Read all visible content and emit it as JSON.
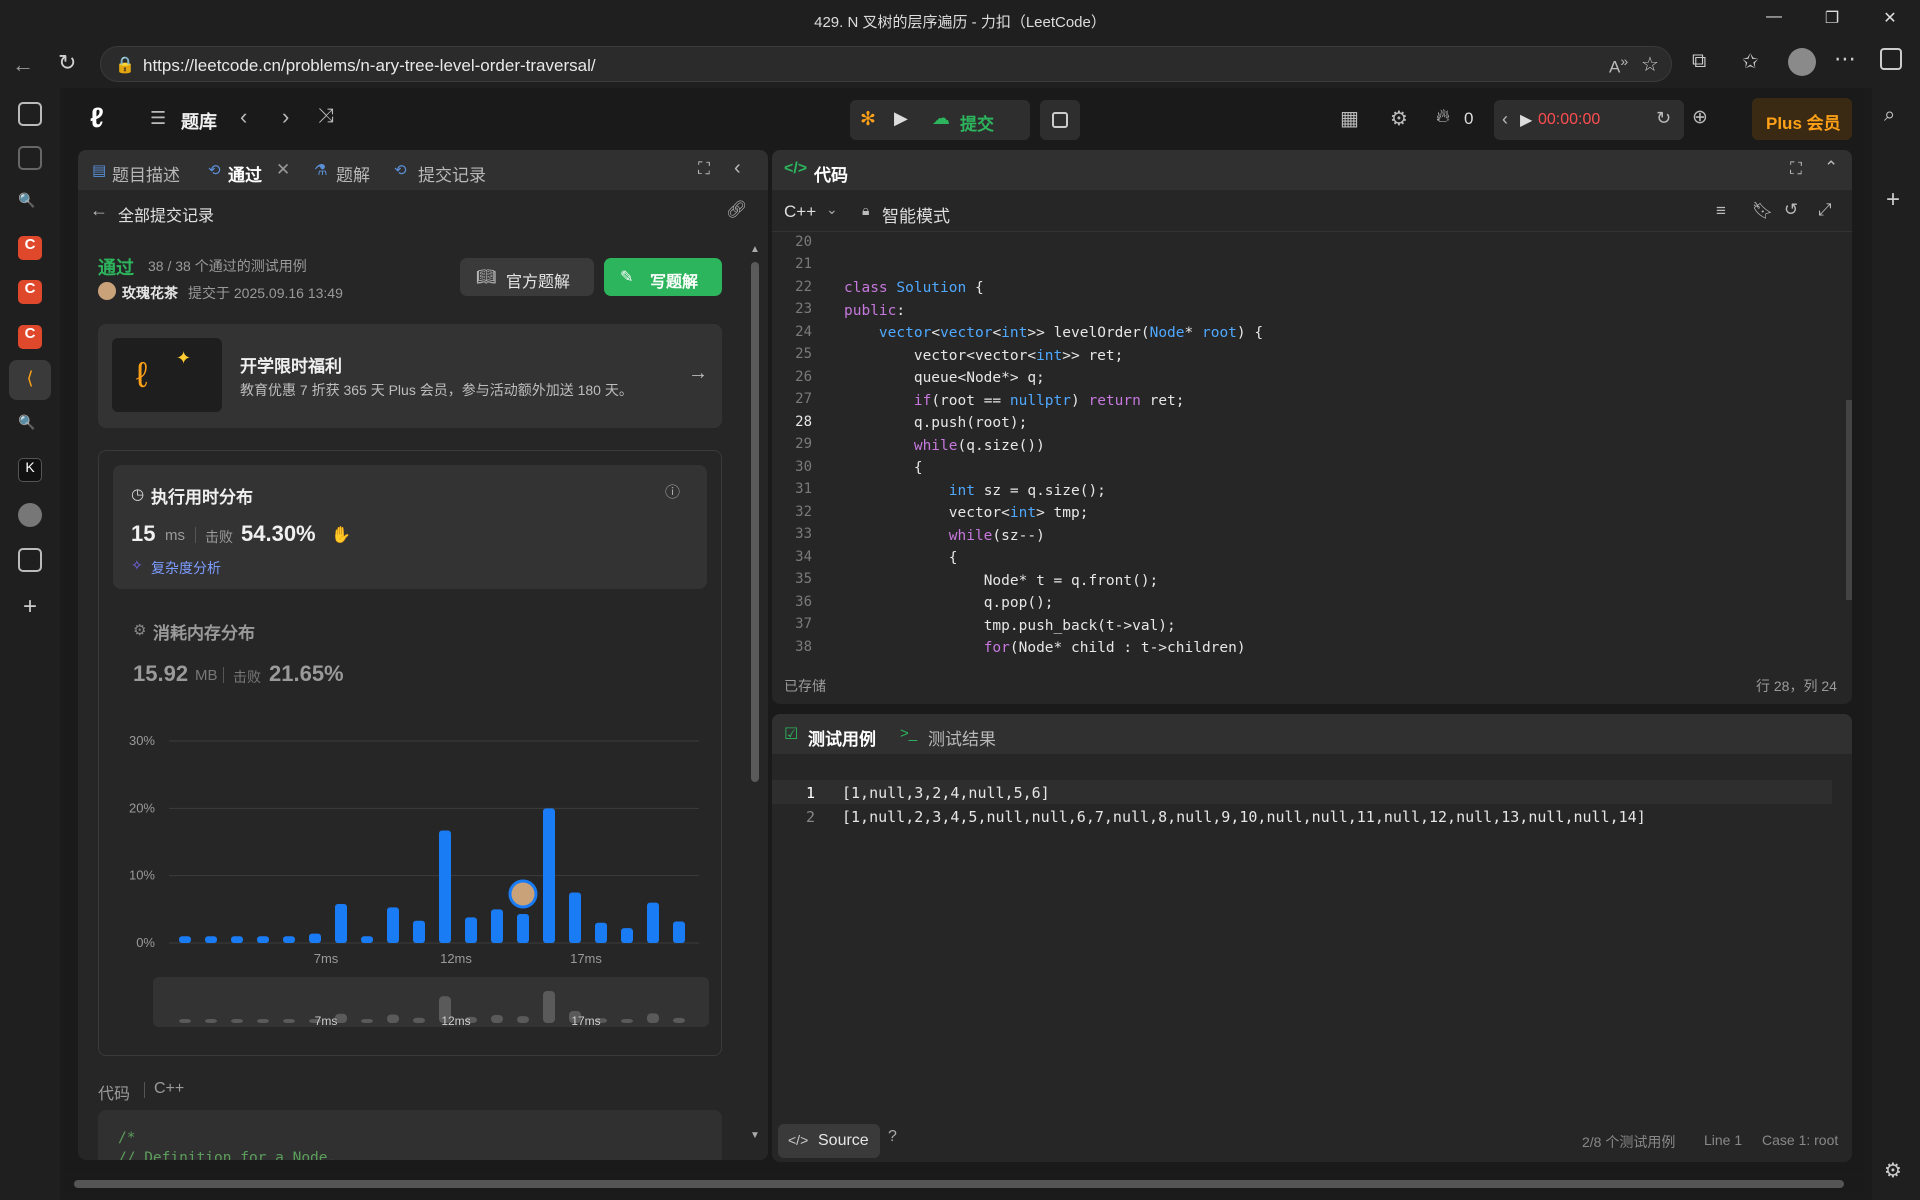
{
  "window": {
    "title": "429. N 叉树的层序遍历 - 力扣（LeetCode）"
  },
  "browser": {
    "url": "https://leetcode.cn/problems/n-ary-tree-level-order-traversal/"
  },
  "nav": {
    "problem_bank": "题库",
    "submit": "提交",
    "streak": "0",
    "timer": "00:00:00",
    "plus": "Plus 会员"
  },
  "left_panel": {
    "tabs": [
      "题目描述",
      "通过",
      "题解",
      "提交记录"
    ],
    "back_label": "全部提交记录",
    "status": "通过",
    "cases": "38 / 38 个通过的测试用例",
    "user": "玫瑰花茶",
    "submitted_at": "提交于 2025.09.16 13:49",
    "official_btn": "官方题解",
    "write_btn": "写题解",
    "promo_title": "开学限时福利",
    "promo_desc": "教育优惠 7 折获 365 天 Plus 会员，参与活动额外加送 180 天。",
    "runtime_title": "执行用时分布",
    "runtime_value": "15",
    "runtime_unit": "ms",
    "beats_label": "击败",
    "runtime_beats": "54.30%",
    "complexity": "复杂度分析",
    "memory_title": "消耗内存分布",
    "memory_value": "15.92",
    "memory_unit": "MB",
    "memory_beats": "21.65%",
    "code_label": "代码",
    "code_lang": "C++",
    "snippet_l1": "/*",
    "snippet_l2": "// Definition for a Node."
  },
  "chart_data": {
    "type": "bar",
    "ylabels": [
      "30%",
      "20%",
      "10%",
      "0%"
    ],
    "ylim": [
      0,
      30
    ],
    "xticks": [
      {
        "label": "7ms",
        "index": 5
      },
      {
        "label": "12ms",
        "index": 10
      },
      {
        "label": "17ms",
        "index": 15
      }
    ],
    "values": [
      1.0,
      1.0,
      1.0,
      1.0,
      1.0,
      1.4,
      5.8,
      1.0,
      5.3,
      3.3,
      16.7,
      3.8,
      5.0,
      4.3,
      20.0,
      7.5,
      3.0,
      2.2,
      6.0,
      3.2
    ],
    "highlight_index": 13
  },
  "editor": {
    "title": "代码",
    "lang": "C++",
    "mode": "智能模式",
    "saved": "已存储",
    "cursor": "行 28，列 24"
  },
  "testcase": {
    "tab1": "测试用例",
    "tab2": "测试结果",
    "line1": "[1,null,3,2,4,null,5,6]",
    "line2": "[1,null,2,3,4,5,null,null,6,7,null,8,null,9,10,null,null,11,null,12,null,13,null,null,14]",
    "source": "Source",
    "passed": "2/8 个测试用例",
    "lineinfo": "Line 1",
    "case": "Case 1: root"
  },
  "colors": {
    "accent_green": "#2db55d",
    "bar_blue": "#1a7cf5",
    "plus_orange": "#ffa116"
  }
}
